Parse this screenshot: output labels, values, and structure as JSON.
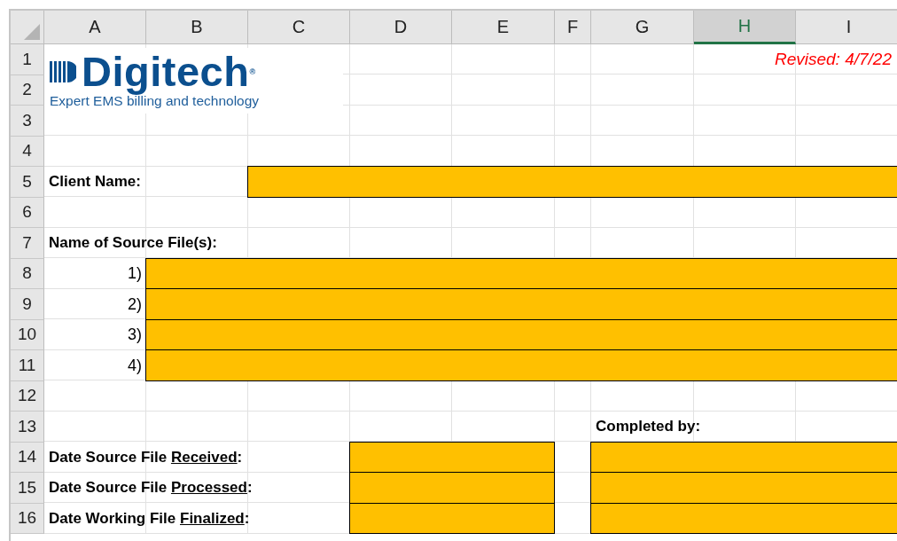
{
  "columns": [
    {
      "label": "A",
      "selected": false
    },
    {
      "label": "B",
      "selected": false
    },
    {
      "label": "C",
      "selected": false
    },
    {
      "label": "D",
      "selected": false
    },
    {
      "label": "E",
      "selected": false
    },
    {
      "label": "F",
      "selected": false
    },
    {
      "label": "G",
      "selected": false
    },
    {
      "label": "H",
      "selected": true
    },
    {
      "label": "I",
      "selected": false
    }
  ],
  "rows": [
    "1",
    "2",
    "3",
    "4",
    "5",
    "6",
    "7",
    "8",
    "9",
    "10",
    "11",
    "12",
    "13",
    "14",
    "15",
    "16"
  ],
  "logo": {
    "wordmark": "Digitech$^{®}$",
    "tagline": "Expert EMS billing and technology"
  },
  "revised": "Revised: 4/7/22",
  "client_name": {
    "label": "Client Name:"
  },
  "source_files": {
    "label": "Name of Source File(s):",
    "items": [
      "1)",
      "2)",
      "3)",
      "4)"
    ]
  },
  "completed_by": "Completed by:",
  "dates": [
    {
      "prefix": "Date Source File ",
      "underlined": "Received",
      "suffix": ":"
    },
    {
      "prefix": "Date Source File ",
      "underlined": "Processed",
      "suffix": ":"
    },
    {
      "prefix": "Date Working File ",
      "underlined": "Finalized",
      "suffix": ":"
    }
  ]
}
